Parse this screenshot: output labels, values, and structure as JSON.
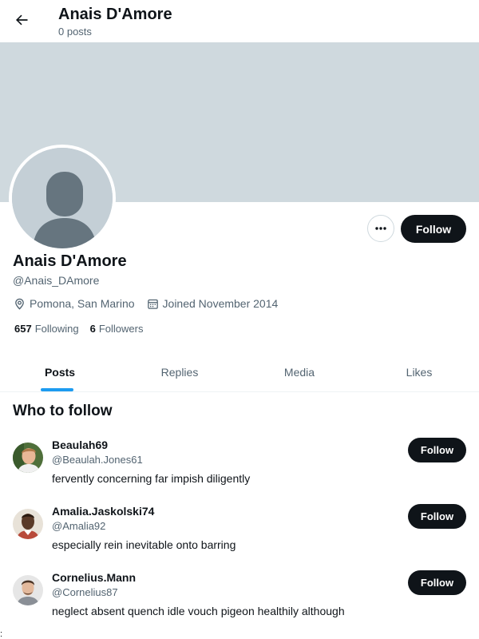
{
  "header": {
    "name": "Anais D'Amore",
    "posts_count": "0 posts"
  },
  "profile": {
    "name": "Anais D'Amore",
    "handle": "@Anais_DAmore",
    "location": "Pomona, San Marino",
    "joined": "Joined November 2014",
    "following_count": "657",
    "following_label": "Following",
    "followers_count": "6",
    "followers_label": "Followers",
    "follow_label": "Follow"
  },
  "tabs": [
    {
      "label": "Posts",
      "active": true
    },
    {
      "label": "Replies",
      "active": false
    },
    {
      "label": "Media",
      "active": false
    },
    {
      "label": "Likes",
      "active": false
    }
  ],
  "who_to_follow": {
    "title": "Who to follow",
    "suggestions": [
      {
        "name": "Beaulah69",
        "handle": "@Beaulah.Jones61",
        "bio": "fervently concerning far impish diligently",
        "follow_label": "Follow"
      },
      {
        "name": "Amalia.Jaskolski74",
        "handle": "@Amalia92",
        "bio": "especially rein inevitable onto barring",
        "follow_label": "Follow"
      },
      {
        "name": "Cornelius.Mann",
        "handle": "@Cornelius87",
        "bio": "neglect absent quench idle vouch pigeon healthily although",
        "follow_label": "Follow"
      }
    ]
  },
  "stray_char": ":",
  "colors": {
    "banner": "#cfd9de",
    "accent": "#1d9bf0",
    "button_dark": "#0f1419",
    "secondary_text": "#536471"
  }
}
